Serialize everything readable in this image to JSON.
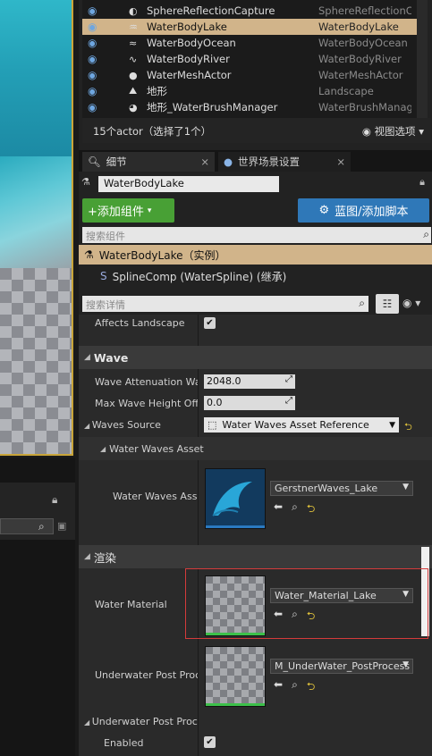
{
  "outliner": {
    "rows": [
      {
        "name": "SphereReflectionCapture",
        "type": "SphereReflectionC",
        "icon": "sphere-capture-icon",
        "selected": false
      },
      {
        "name": "WaterBodyLake",
        "type": "WaterBodyLake",
        "icon": "water-lake-icon",
        "selected": true
      },
      {
        "name": "WaterBodyOcean",
        "type": "WaterBodyOcean",
        "icon": "water-ocean-icon",
        "selected": false
      },
      {
        "name": "WaterBodyRiver",
        "type": "WaterBodyRiver",
        "icon": "water-river-icon",
        "selected": false
      },
      {
        "name": "WaterMeshActor",
        "type": "WaterMeshActor",
        "icon": "sphere-icon",
        "selected": false
      },
      {
        "name": "地形",
        "type": "Landscape",
        "icon": "landscape-icon",
        "selected": false
      },
      {
        "name": "地形_WaterBrushManager",
        "type": "WaterBrushManag",
        "icon": "brush-manager-icon",
        "selected": false
      }
    ],
    "count_text": "15个actor（选择了1个）",
    "view_options": "视图选项"
  },
  "tabs": [
    {
      "label": "细节",
      "icon": "details-icon"
    },
    {
      "label": "世界场景设置",
      "icon": "globe-icon"
    }
  ],
  "details": {
    "actor_name": "WaterBodyLake",
    "add_component": "+添加组件",
    "blueprint_button": "蓝图/添加脚本",
    "component_search_placeholder": "搜索组件",
    "components": [
      {
        "label": "WaterBodyLake（实例）"
      },
      {
        "label": "SplineComp (WaterSpline) (继承)"
      }
    ],
    "details_search_placeholder": "搜索详情"
  },
  "properties": {
    "affects_landscape_label": "Affects Landscape",
    "affects_landscape": true,
    "wave_category": "Wave",
    "wave_attenuation_label": "Wave Attenuation Wate",
    "wave_attenuation_value": "2048.0",
    "max_wave_height_label": "Max Wave Height Offse",
    "max_wave_height_value": "0.0",
    "waves_source_label": "Waves Source",
    "waves_source_value": "Water Waves Asset Reference",
    "water_waves_asset_subcat": "Water Waves Asset",
    "water_waves_asset_label": "Water Waves Asset",
    "water_waves_asset_value": "GerstnerWaves_Lake",
    "render_category": "渲染",
    "water_material_label": "Water Material",
    "water_material_value": "Water_Material_Lake",
    "underwater_pp_label": "Underwater Post Proce",
    "underwater_pp_value": "M_UnderWater_PostProcess",
    "underwater_pp_subcat": "Underwater Post Proce",
    "enabled_label": "Enabled",
    "enabled": true
  },
  "colors": {
    "selection": "#d1b48a",
    "add_button": "#48a035",
    "blueprint_button": "#2f78b8",
    "highlight": "#d43b3b",
    "reset_arrow": "#e0c23b"
  }
}
